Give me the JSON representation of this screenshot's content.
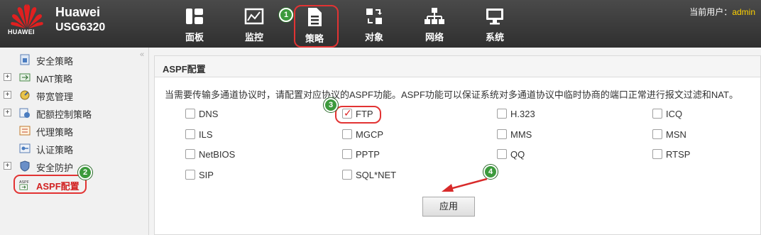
{
  "header": {
    "logo_text": "HUAWEI",
    "brand_line1": "Huawei",
    "brand_line2": "USG6320",
    "user_label": "当前用户：",
    "user_name": "admin"
  },
  "nav": {
    "items": [
      {
        "label": "面板",
        "icon": "dashboard-icon"
      },
      {
        "label": "监控",
        "icon": "monitor-chart-icon"
      },
      {
        "label": "策略",
        "icon": "policy-document-icon"
      },
      {
        "label": "对象",
        "icon": "object-icon"
      },
      {
        "label": "网络",
        "icon": "network-icon"
      },
      {
        "label": "系统",
        "icon": "system-monitor-icon"
      }
    ],
    "active": "策略"
  },
  "sidebar": {
    "collapse_icon": "«",
    "items": [
      {
        "label": "安全策略",
        "expandable": false,
        "icon": "security-policy-icon"
      },
      {
        "label": "NAT策略",
        "expandable": true,
        "icon": "nat-icon"
      },
      {
        "label": "带宽管理",
        "expandable": true,
        "icon": "bandwidth-icon"
      },
      {
        "label": "配额控制策略",
        "expandable": true,
        "icon": "quota-icon"
      },
      {
        "label": "代理策略",
        "expandable": false,
        "icon": "proxy-icon"
      },
      {
        "label": "认证策略",
        "expandable": false,
        "icon": "auth-icon"
      },
      {
        "label": "安全防护",
        "expandable": true,
        "icon": "shield-icon"
      },
      {
        "label": "ASPF配置",
        "expandable": false,
        "icon": "aspf-icon",
        "active": true
      }
    ]
  },
  "panel": {
    "title": "ASPF配置",
    "description": "当需要传输多通道协议时，请配置对应协议的ASPF功能。ASPF功能可以保证系统对多通道协议中临时协商的端口正常进行报文过滤和NAT。",
    "protocols": [
      {
        "label": "DNS",
        "checked": false
      },
      {
        "label": "FTP",
        "checked": true
      },
      {
        "label": "H.323",
        "checked": false
      },
      {
        "label": "ICQ",
        "checked": false
      },
      {
        "label": "ILS",
        "checked": false
      },
      {
        "label": "MGCP",
        "checked": false
      },
      {
        "label": "MMS",
        "checked": false
      },
      {
        "label": "MSN",
        "checked": false
      },
      {
        "label": "NetBIOS",
        "checked": false
      },
      {
        "label": "PPTP",
        "checked": false
      },
      {
        "label": "QQ",
        "checked": false
      },
      {
        "label": "RTSP",
        "checked": false
      },
      {
        "label": "SIP",
        "checked": false
      },
      {
        "label": "SQL*NET",
        "checked": false
      }
    ],
    "apply_label": "应用"
  },
  "annotations": {
    "step1": "1",
    "step2": "2",
    "step3": "3",
    "step4": "4"
  },
  "colors": {
    "topbar": "#3a3a3a",
    "highlight_ring": "#e23333",
    "badge_green": "#3c9a3c",
    "username": "#ffd200",
    "active_sidebar_text": "#d22222"
  }
}
